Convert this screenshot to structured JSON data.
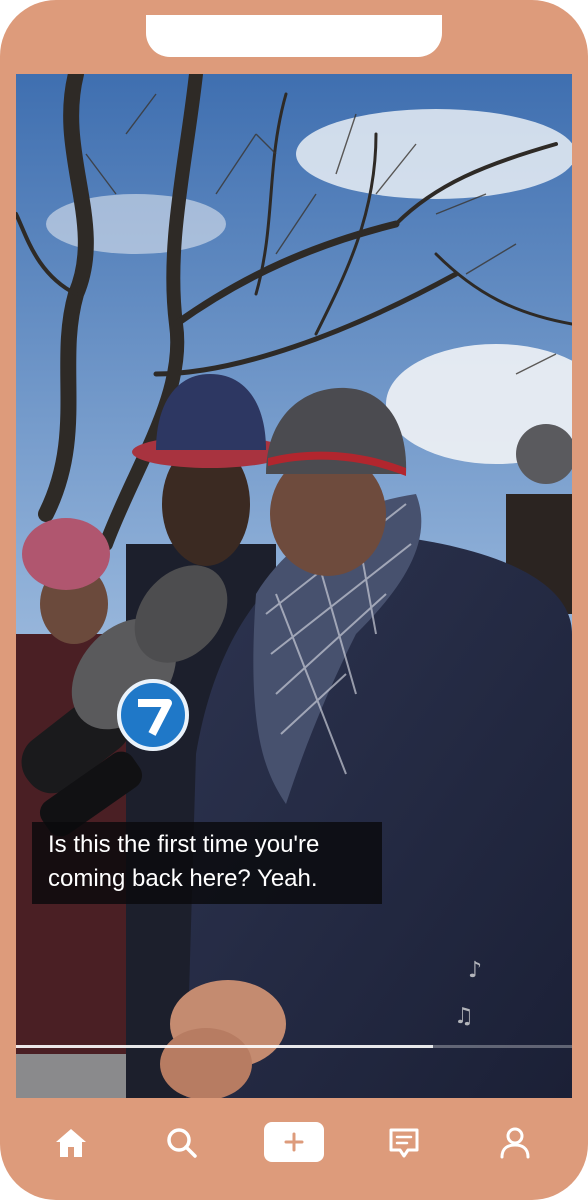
{
  "video": {
    "caption_lines": [
      "Is this the first time you're",
      "coming back here? Yeah."
    ],
    "progress": 0.75,
    "station_logo": "abc7-logo",
    "music_icon": "music-note-icon"
  },
  "nav": {
    "items": [
      {
        "icon": "home-icon"
      },
      {
        "icon": "search-icon"
      },
      {
        "icon": "plus-icon"
      },
      {
        "icon": "inbox-icon"
      },
      {
        "icon": "profile-icon"
      }
    ]
  },
  "colors": {
    "frame": "#dd9b7b",
    "caption_bg": "#0a0a0c",
    "caption_text": "#ffffff",
    "create_button_bg": "#ffffff",
    "create_button_icon": "#dd9b7b"
  }
}
